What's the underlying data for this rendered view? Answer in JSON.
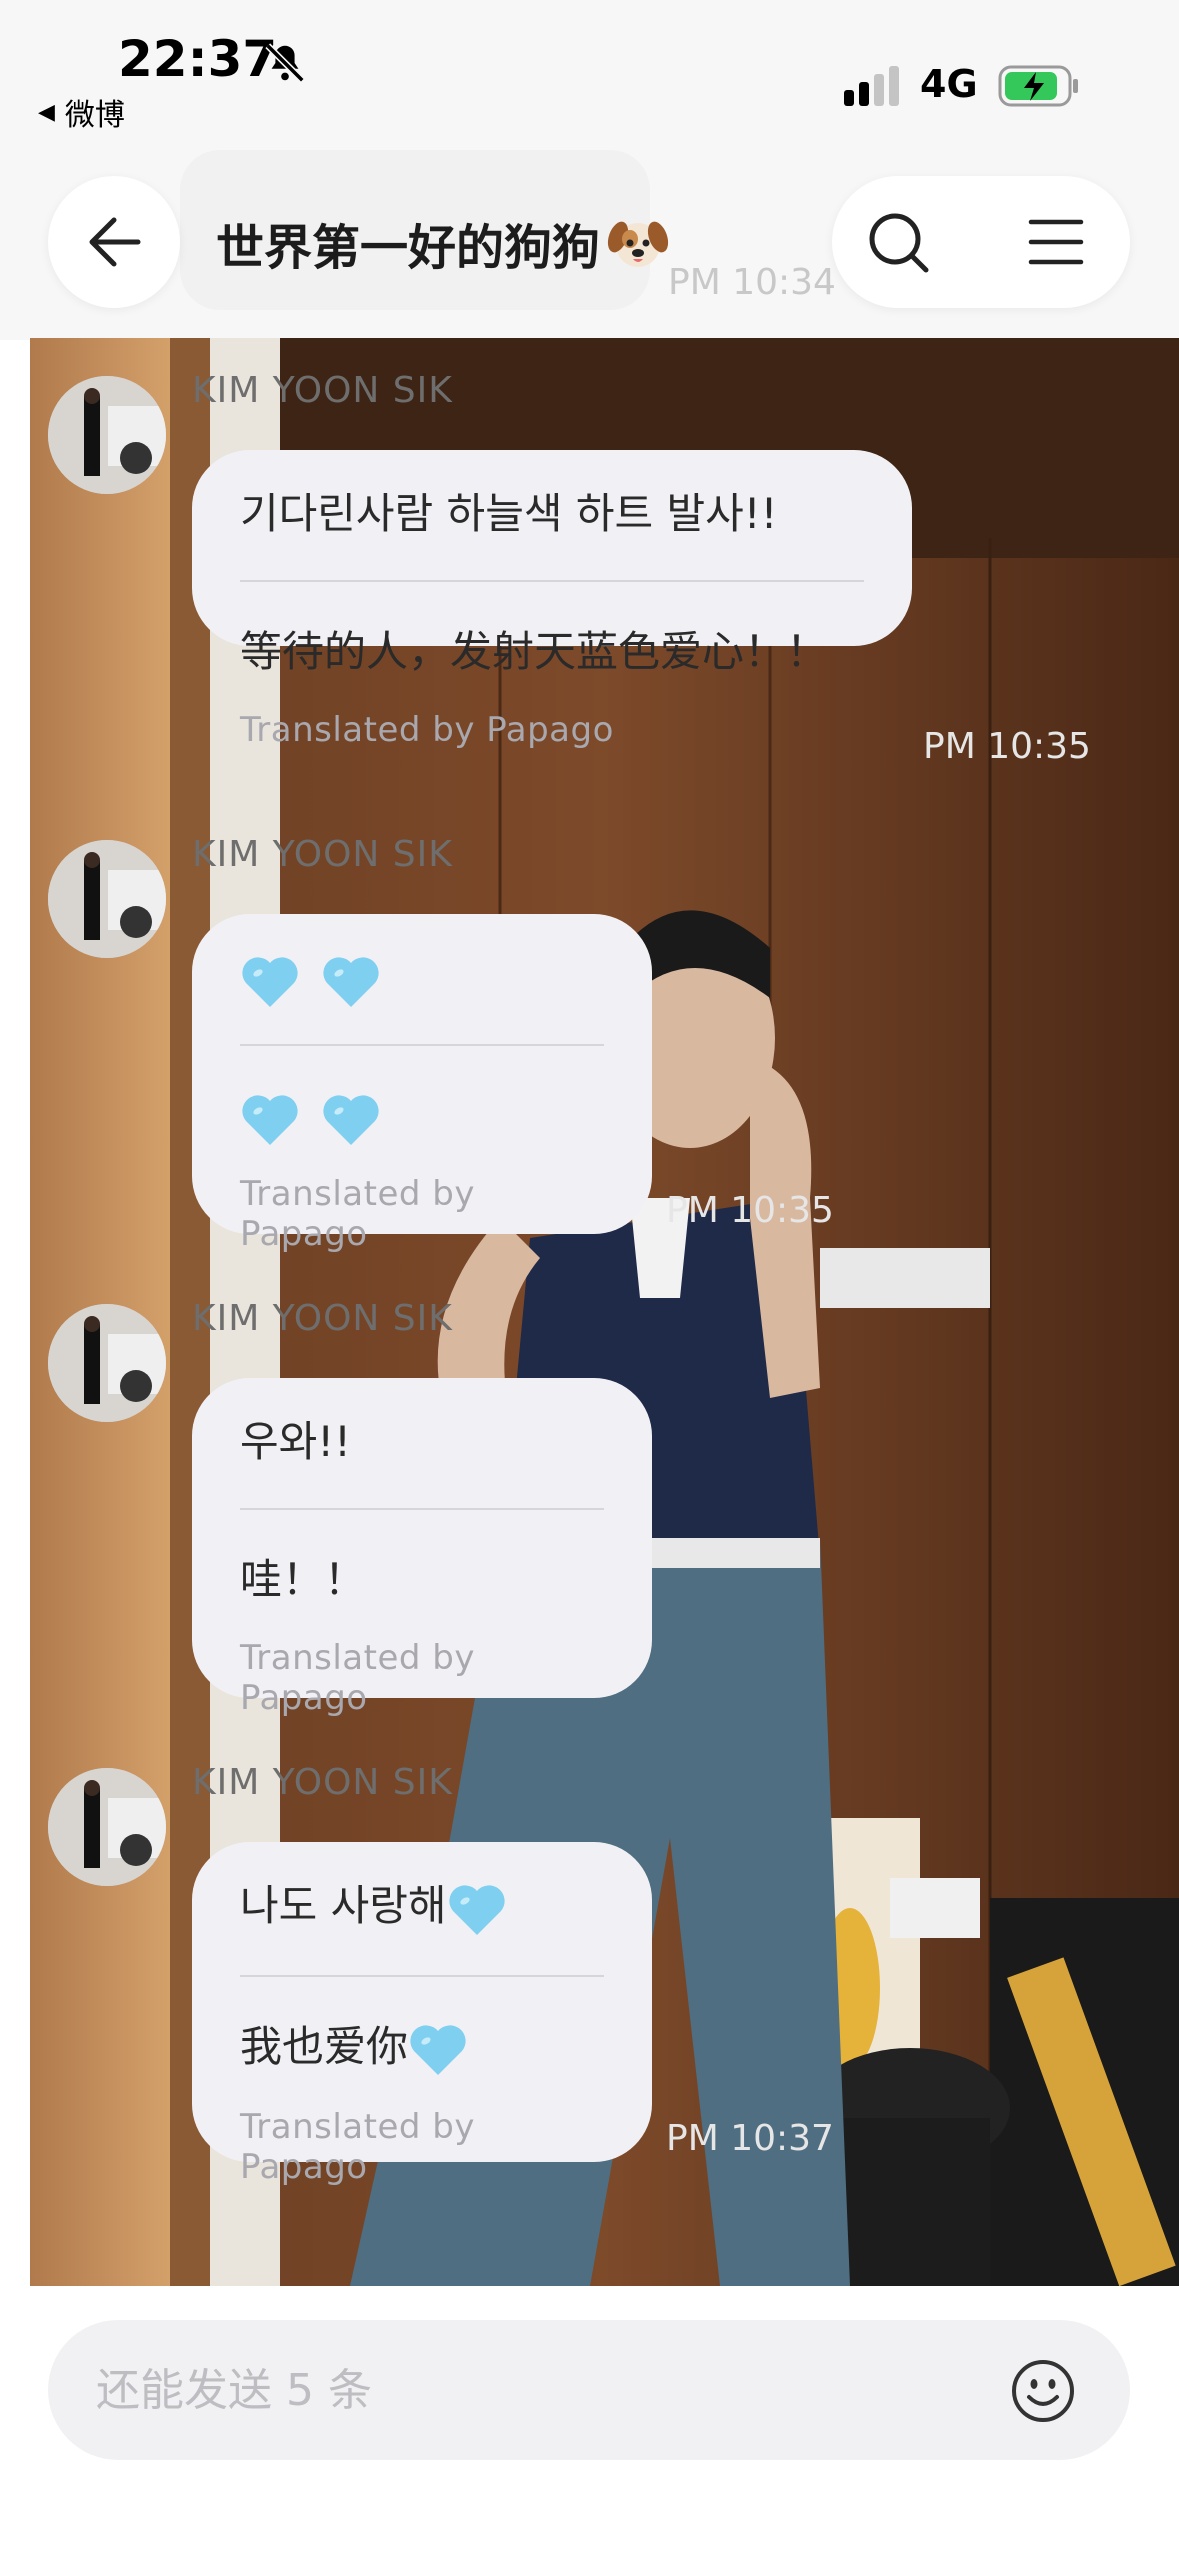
{
  "status_bar": {
    "time": "22:37",
    "back_app": "微博",
    "network": "4G"
  },
  "header": {
    "title": "世界第一好的狗狗",
    "ghost_time": "PM 10:34"
  },
  "messages": [
    {
      "sender": "KIM YOON SIK",
      "original": "기다린사람 하늘색 하트 발사!!",
      "translation": "等待的人，发射天蓝色爱心！！",
      "translated_by": "Translated by Papago",
      "time": "PM 10:35"
    },
    {
      "sender": "KIM YOON SIK",
      "original_hearts": 2,
      "translation_hearts": 2,
      "translated_by": "Translated by Papago",
      "time": "PM 10:35"
    },
    {
      "sender": "KIM YOON SIK",
      "original": "우와!!",
      "translation": "哇！！",
      "translated_by": "Translated by Papago"
    },
    {
      "sender": "KIM YOON SIK",
      "original": "나도 사랑해",
      "translation": "我也爱你",
      "translated_by": "Translated by Papago",
      "time": "PM 10:37"
    }
  ],
  "input": {
    "placeholder": "还能发送 5 条"
  },
  "colors": {
    "bubble": "#f1f1f5",
    "heart": "#7fcff0",
    "battery": "#34c759"
  },
  "icons": [
    "bell-slash-icon",
    "signal-icon",
    "battery-charging-icon",
    "back-arrow-icon",
    "dog-emoji-icon",
    "search-icon",
    "menu-icon",
    "light-blue-heart-icon",
    "smiley-icon"
  ]
}
